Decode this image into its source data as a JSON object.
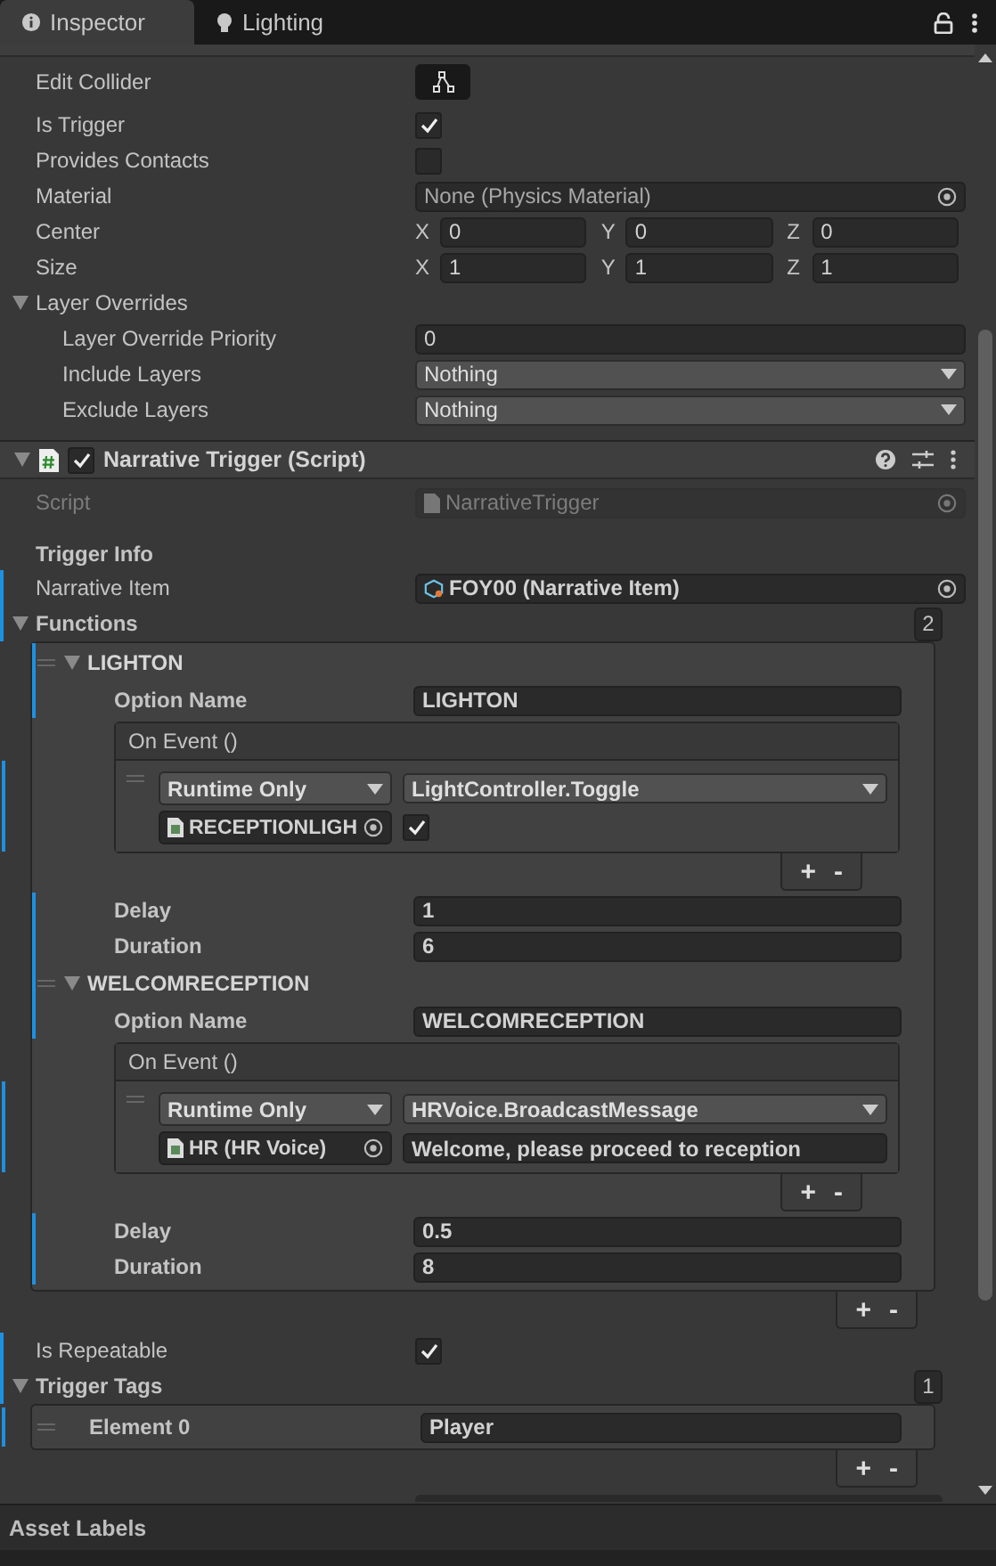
{
  "tabs": [
    {
      "label": "Inspector",
      "selected": true
    },
    {
      "label": "Lighting",
      "selected": false
    }
  ],
  "box_collider": {
    "rows": [
      {
        "kind": "button",
        "label": "Edit Collider"
      },
      {
        "kind": "checkbox",
        "label": "Is Trigger",
        "checked": true
      },
      {
        "kind": "checkbox",
        "label": "Provides Contacts",
        "checked": false
      },
      {
        "kind": "object",
        "label": "Material",
        "value": "None (Physics Material)"
      },
      {
        "kind": "vector",
        "label": "Center",
        "axes": [
          {
            "axis": "X",
            "value": "0"
          },
          {
            "axis": "Y",
            "value": "0"
          },
          {
            "axis": "Z",
            "value": "0"
          }
        ]
      },
      {
        "kind": "vector",
        "label": "Size",
        "axes": [
          {
            "axis": "X",
            "value": "1"
          },
          {
            "axis": "Y",
            "value": "1"
          },
          {
            "axis": "Z",
            "value": "1"
          }
        ]
      },
      {
        "kind": "foldout",
        "label": "Layer Overrides",
        "expanded": true,
        "children": [
          {
            "kind": "text",
            "label": "Layer Override Priority",
            "value": "0"
          },
          {
            "kind": "dropdown",
            "label": "Include Layers",
            "value": "Nothing"
          },
          {
            "kind": "dropdown",
            "label": "Exclude Layers",
            "value": "Nothing"
          }
        ]
      }
    ]
  },
  "narrative_trigger": {
    "title": "Narrative Trigger (Script)",
    "enabled": true,
    "script": {
      "label": "Script",
      "value": "NarrativeTrigger",
      "disabled": true
    },
    "heading": "Trigger Info",
    "narrative_item": {
      "label": "Narrative Item",
      "value": "FOY00 (Narrative Item)"
    },
    "functions": {
      "label": "Functions",
      "count": "2",
      "expanded": true,
      "items": [
        {
          "title": "LIGHTON",
          "expanded": true,
          "option_label": "Option Name",
          "option_name": "LIGHTON",
          "event_title": "On Event ()",
          "listener": {
            "mode": "Runtime Only",
            "method": "LightController.Toggle",
            "target": "RECEPTIONLIGH",
            "kind": "checkbox",
            "checked": true
          },
          "add": "+",
          "remove": "-",
          "delay_label": "Delay",
          "delay": "1",
          "duration_label": "Duration",
          "duration": "6"
        },
        {
          "title": "WELCOMRECEPTION",
          "expanded": true,
          "option_label": "Option Name",
          "option_name": "WELCOMRECEPTION",
          "event_title": "On Event ()",
          "listener": {
            "mode": "Runtime Only",
            "method": "HRVoice.BroadcastMessage",
            "target": "HR (HR Voice)",
            "kind": "text",
            "value": "Welcome, please proceed to reception"
          },
          "add": "+",
          "remove": "-",
          "delay_label": "Delay",
          "delay": "0.5",
          "duration_label": "Duration",
          "duration": "8"
        }
      ],
      "add": "+",
      "remove": "-"
    },
    "is_repeatable": {
      "label": "Is Repeatable",
      "checked": true
    },
    "trigger_tags": {
      "label": "Trigger Tags",
      "count": "1",
      "expanded": true,
      "items": [
        {
          "label": "Element 0",
          "value": "Player"
        }
      ],
      "add": "+",
      "remove": "-"
    }
  },
  "footer": {
    "title": "Asset Labels"
  }
}
